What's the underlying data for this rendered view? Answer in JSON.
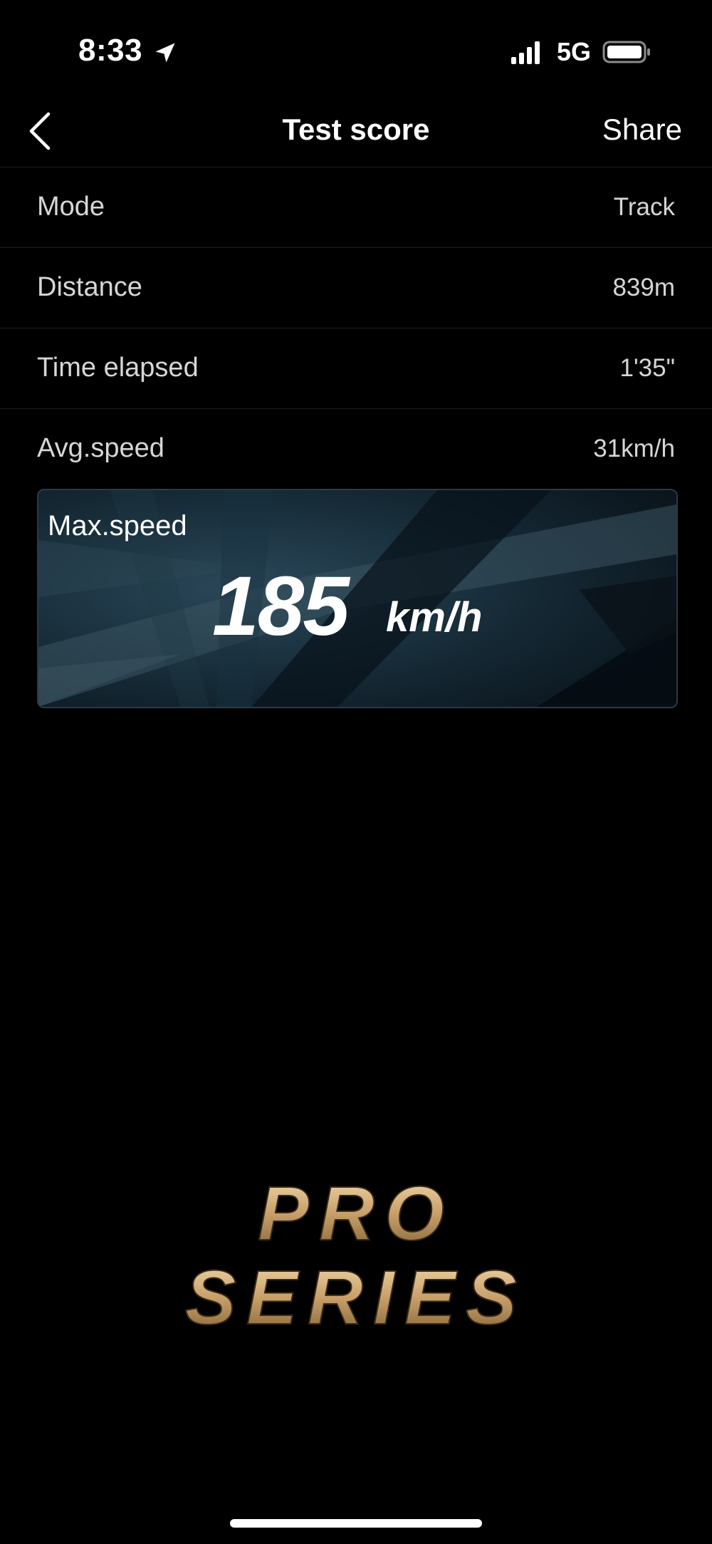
{
  "status_bar": {
    "time": "8:33",
    "network": "5G",
    "icons": [
      "location-arrow-icon",
      "cellular-signal-icon",
      "battery-icon"
    ]
  },
  "nav": {
    "title": "Test score",
    "share_label": "Share",
    "back_icon": "chevron-left-icon"
  },
  "rows": [
    {
      "label": "Mode",
      "value": "Track"
    },
    {
      "label": "Distance",
      "value": "839m"
    },
    {
      "label": "Time elapsed",
      "value": "1'35\""
    },
    {
      "label": "Avg.speed",
      "value": "31km/h"
    }
  ],
  "max_speed": {
    "label": "Max.speed",
    "value": "185",
    "unit": "km/h"
  },
  "logo": {
    "line1": "PRO",
    "line2": "SERIES",
    "color_light": "#f3dcb0",
    "color_dark": "#8a6a3c"
  },
  "colors": {
    "background": "#000000",
    "text": "#ffffff",
    "secondary_text": "#d6d6d6",
    "card_accent": "#1d3442"
  }
}
